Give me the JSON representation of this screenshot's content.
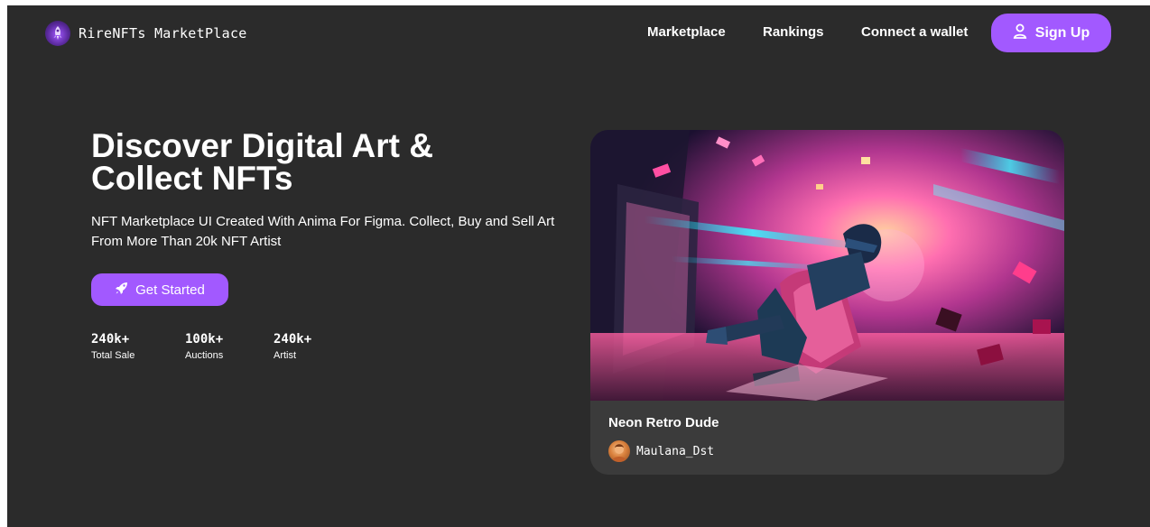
{
  "brand": {
    "name": "RireNFTs MarketPlace",
    "logo_icon": "rocket-icon"
  },
  "nav": {
    "links": [
      "Marketplace",
      "Rankings",
      "Connect a wallet"
    ],
    "signup_label": "Sign Up",
    "signup_icon": "user-icon"
  },
  "hero": {
    "title_line1": "Discover Digital Art &",
    "title_line2": "Collect NFTs",
    "subtitle_line1": "NFT Marketplace UI Created With Anima For Figma. Collect, Buy and Sell Art",
    "subtitle_line2": "From More Than 20k NFT Artist",
    "cta_label": "Get Started",
    "cta_icon": "rocket-icon"
  },
  "stats": [
    {
      "value": "240k+",
      "label": "Total Sale"
    },
    {
      "value": "100k+",
      "label": "Auctions"
    },
    {
      "value": "240k+",
      "label": "Artist"
    }
  ],
  "featured": {
    "title": "Neon Retro Dude",
    "artist": "Maulana_Dst"
  },
  "colors": {
    "background": "#2b2b2b",
    "accent": "#a259ff",
    "card": "#3b3b3b",
    "text": "#ffffff"
  }
}
